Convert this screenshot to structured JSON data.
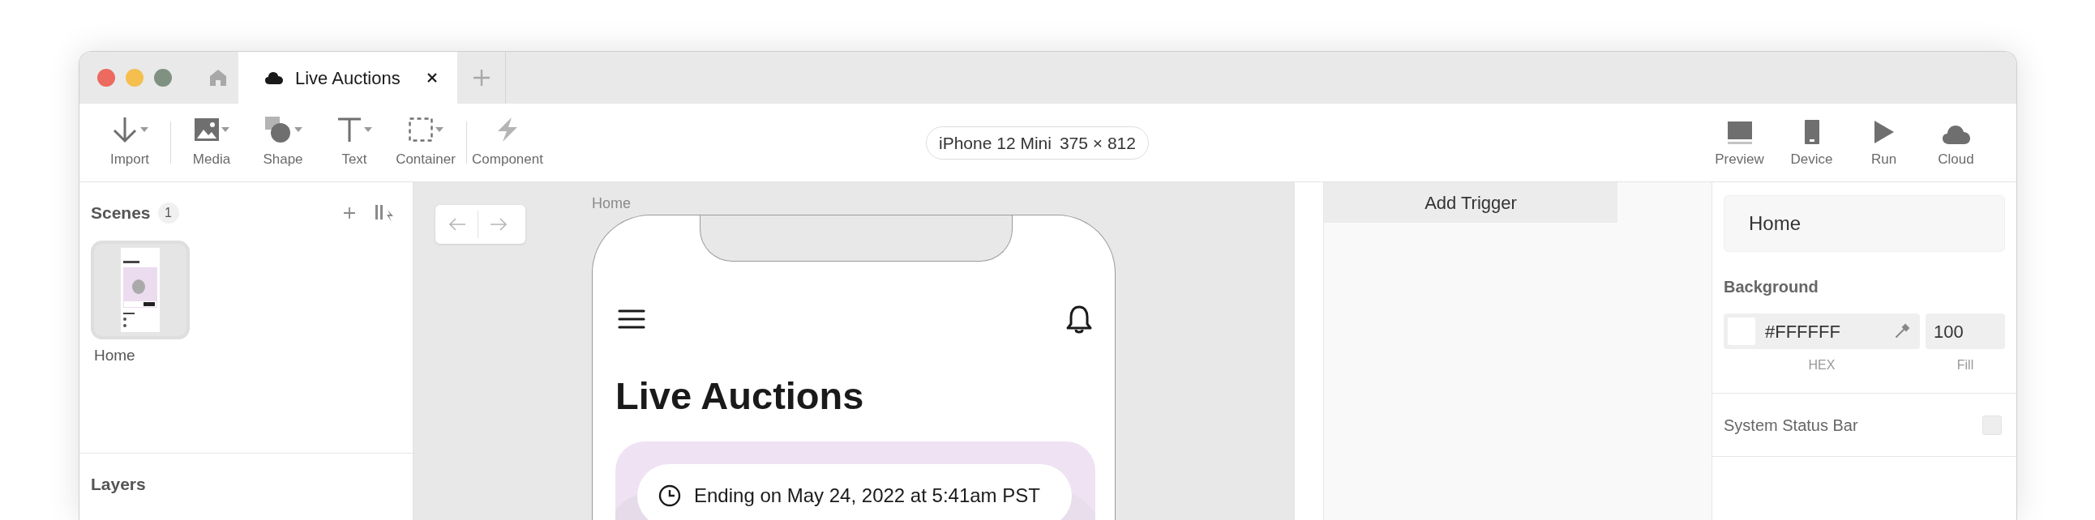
{
  "window": {
    "tabs": [
      {
        "label": "Live Auctions",
        "selected": true
      }
    ]
  },
  "toolbar": {
    "groups": [
      [
        {
          "kind": "import",
          "label": "Import",
          "dropdown": true
        }
      ],
      [
        {
          "kind": "media",
          "label": "Media",
          "dropdown": true
        },
        {
          "kind": "shape",
          "label": "Shape",
          "dropdown": true
        },
        {
          "kind": "text",
          "label": "Text",
          "dropdown": true
        },
        {
          "kind": "container",
          "label": "Container",
          "dropdown": true
        }
      ],
      [
        {
          "kind": "component",
          "label": "Component",
          "dropdown": false
        }
      ]
    ],
    "device": {
      "name": "iPhone 12 Mini",
      "size": "375 × 812"
    },
    "actions": [
      {
        "kind": "preview",
        "label": "Preview"
      },
      {
        "kind": "device",
        "label": "Device"
      },
      {
        "kind": "run",
        "label": "Run"
      },
      {
        "kind": "cloud",
        "label": "Cloud"
      }
    ]
  },
  "scenes": {
    "title": "Scenes",
    "count": "1",
    "items": [
      {
        "label": "Home",
        "selected": true
      }
    ]
  },
  "layers": {
    "title": "Layers"
  },
  "canvas": {
    "scene_label": "Home",
    "phone": {
      "title": "Live Auctions",
      "auction_card": {
        "ending": "Ending on May 24, 2022 at 5:41am PST"
      }
    }
  },
  "interactions": {
    "add_trigger": "Add Trigger"
  },
  "properties": {
    "scene_name": "Home",
    "background_label": "Background",
    "hex": "#FFFFFF",
    "hex_caption": "HEX",
    "fill": "100",
    "fill_caption": "Fill",
    "status_bar": {
      "label": "System Status Bar",
      "checked": false
    }
  }
}
